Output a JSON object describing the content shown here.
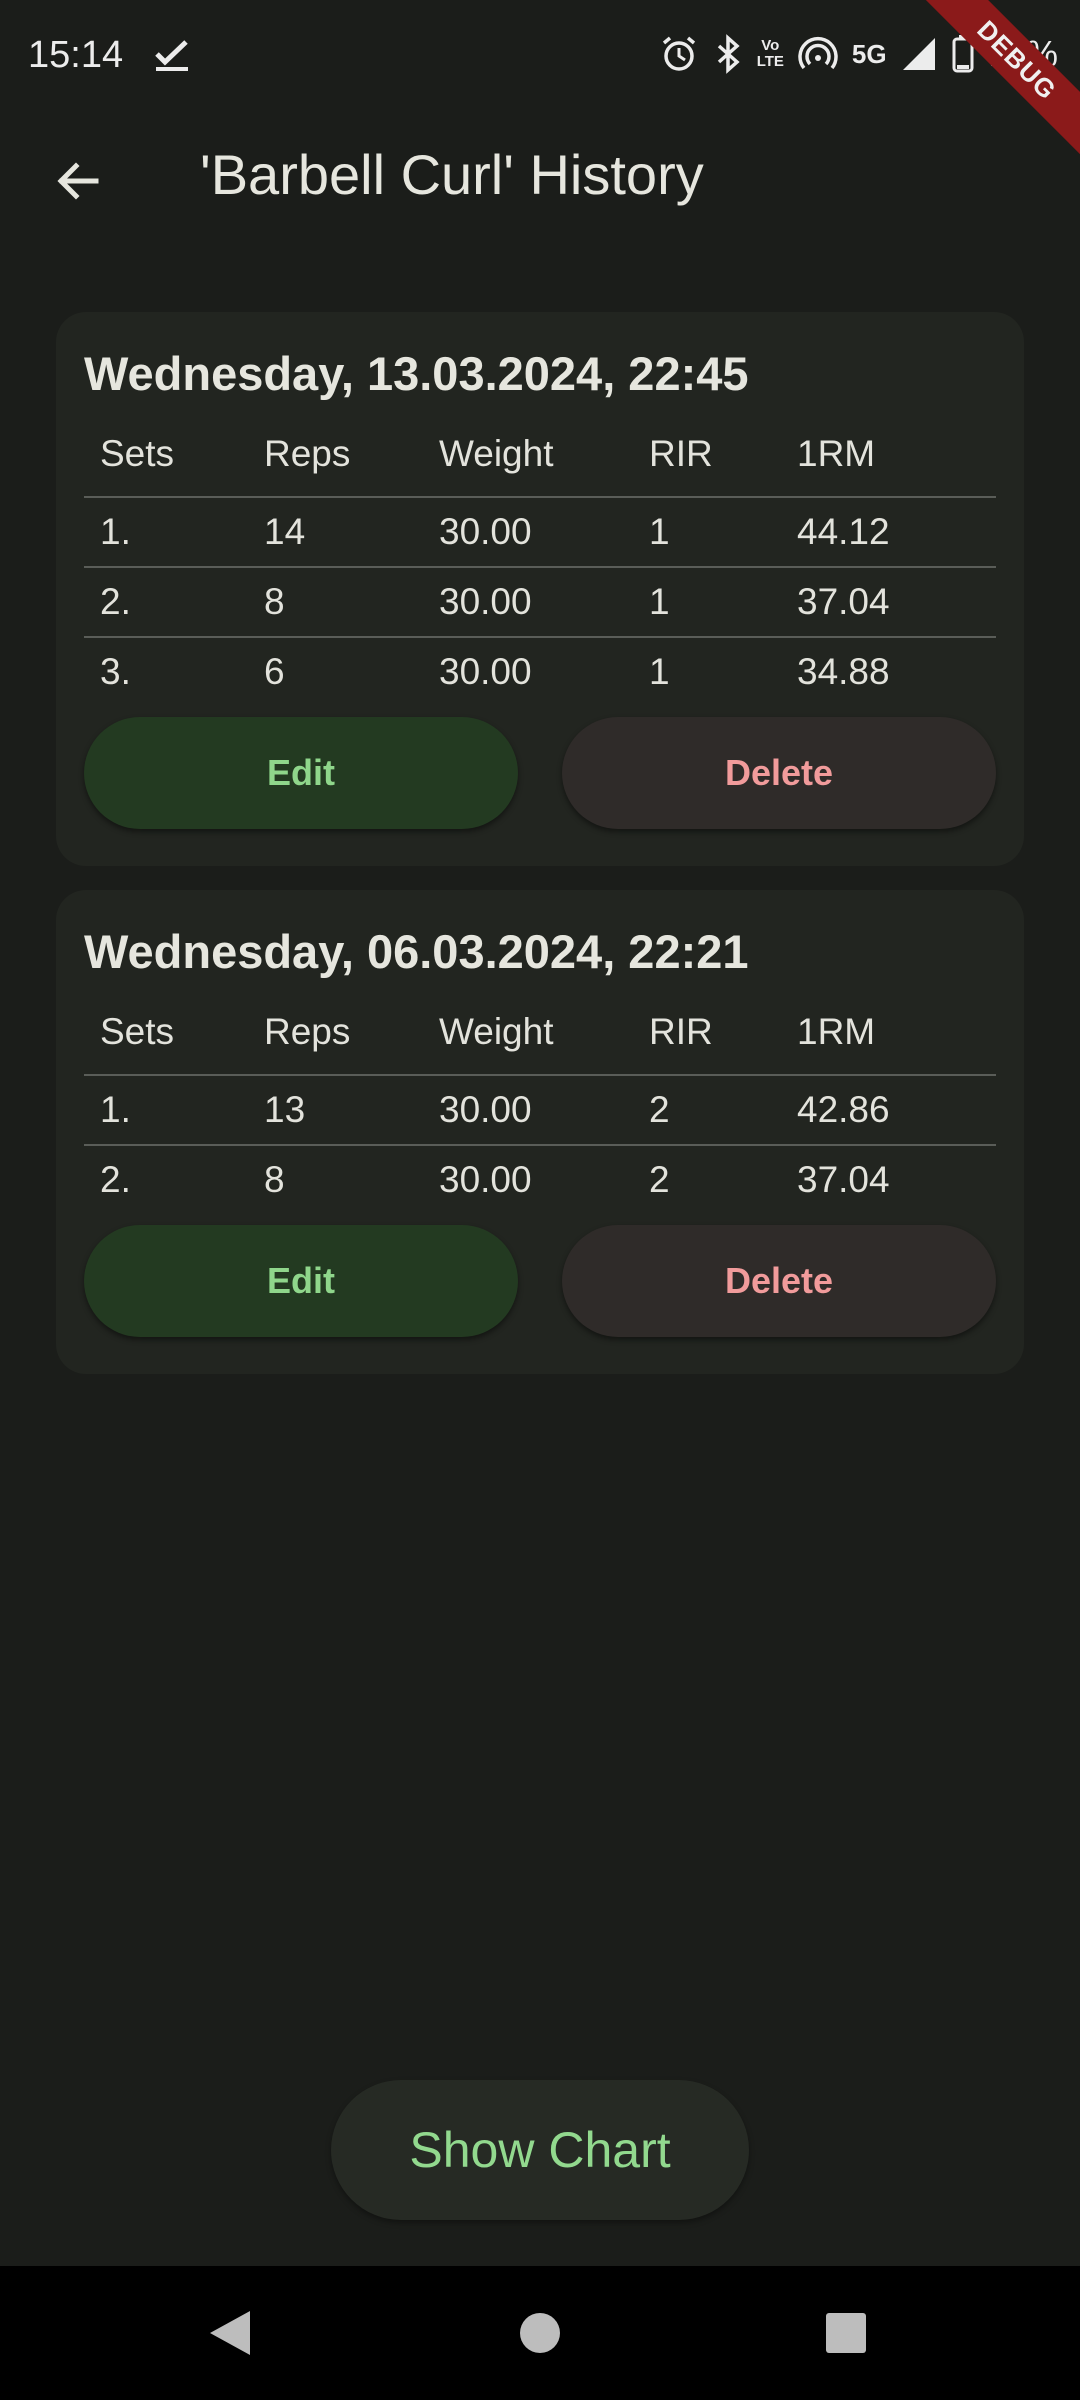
{
  "status_bar": {
    "time": "15:14",
    "network_label": "5G",
    "volte_label": "Vo\nLTE",
    "battery_text": "11%",
    "debug_label": "DEBUG"
  },
  "app_bar": {
    "title": "'Barbell Curl' History"
  },
  "table_headers": [
    "Sets",
    "Reps",
    "Weight",
    "RIR",
    "1RM"
  ],
  "workouts": [
    {
      "date": "Wednesday, 13.03.2024, 22:45",
      "sets": [
        {
          "set": "1.",
          "reps": "14",
          "weight": "30.00",
          "rir": "1",
          "one_rm": "44.12"
        },
        {
          "set": "2.",
          "reps": "8",
          "weight": "30.00",
          "rir": "1",
          "one_rm": "37.04"
        },
        {
          "set": "3.",
          "reps": "6",
          "weight": "30.00",
          "rir": "1",
          "one_rm": "34.88"
        }
      ],
      "edit_label": "Edit",
      "delete_label": "Delete"
    },
    {
      "date": "Wednesday, 06.03.2024, 22:21",
      "sets": [
        {
          "set": "1.",
          "reps": "13",
          "weight": "30.00",
          "rir": "2",
          "one_rm": "42.86"
        },
        {
          "set": "2.",
          "reps": "8",
          "weight": "30.00",
          "rir": "2",
          "one_rm": "37.04"
        }
      ],
      "edit_label": "Edit",
      "delete_label": "Delete"
    }
  ],
  "show_chart_label": "Show Chart",
  "colors": {
    "background": "#1b1d1a",
    "card": "#222520",
    "edit_bg": "#233a21",
    "edit_text": "#8fd68b",
    "delete_bg": "#2f2b29",
    "delete_text": "#f19b9b",
    "debug_banner": "#8b1a1a"
  }
}
